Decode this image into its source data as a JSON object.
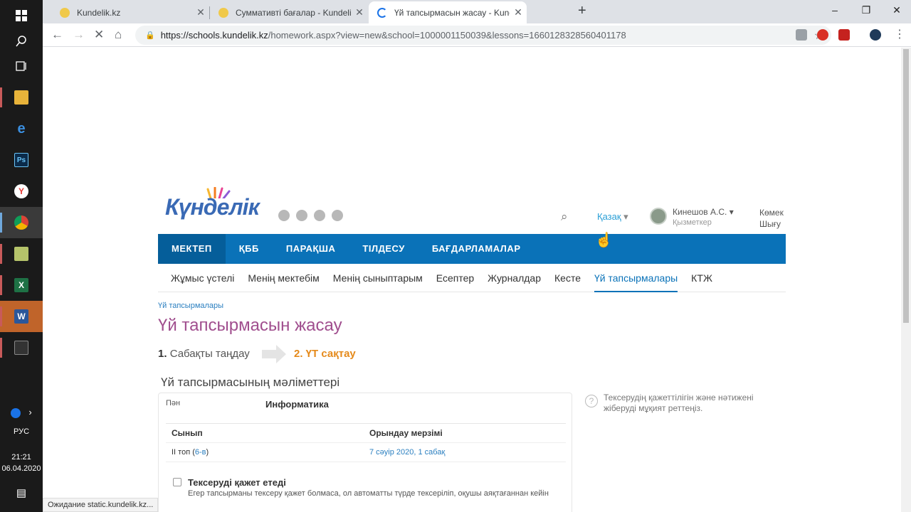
{
  "taskbar": {
    "language": "РУС",
    "time": "21:21",
    "date": "06.04.2020"
  },
  "browser": {
    "tabs": [
      {
        "title": "Kundelik.kz"
      },
      {
        "title": "Суммативті бағалар - Kundelik.k"
      },
      {
        "title": "Үй тапсырмасын жасау - Kunde"
      }
    ],
    "url_domain": "https://schools.kundelik.kz",
    "url_path": "/homework.aspx?view=new&school=1000001150039&lessons=1660128328560401178",
    "status": "Ожидание static.kundelik.kz..."
  },
  "site": {
    "logo": "Күнделік",
    "language": "Қазақ",
    "user_name": "Кинешов А.С.",
    "user_role": "Қызметкер",
    "help": "Көмек",
    "logout": "Шығу"
  },
  "main_nav": [
    "МЕКТЕП",
    "ҚББ",
    "ПАРАҚША",
    "ТІЛДЕСУ",
    "БАҒДАРЛАМАЛАР"
  ],
  "sub_nav": [
    "Жұмыс үстелі",
    "Менің мектебім",
    "Менің сыныптарым",
    "Есептер",
    "Журналдар",
    "Кесте",
    "Үй тапсырмалары",
    "КТЖ"
  ],
  "content": {
    "breadcrumb": "Үй тапсырмалары",
    "page_title": "Үй тапсырмасын жасау",
    "step1_num": "1.",
    "step1_label": "Сабақты таңдау",
    "step2": "2. ҮТ сақтау",
    "section_title": "Үй тапсырмасының мәліметтері",
    "subject_label": "Пән",
    "subject_value": "Информатика",
    "col_class": "Сынып",
    "col_due": "Орындау мерзімі",
    "class_group": "ІІ топ (",
    "class_link": "6-в",
    "class_close": ")",
    "due_value": "7 сәуір 2020, 1 сабақ",
    "check_label": "Тексеруді қажет етеді",
    "check_desc": "Егер тапсырманы тексеру қажет болмаса, ол автоматты түрде тексеріліп, оқушы аяқтағаннан кейін",
    "hint": "Тексерудің қажеттілігін және нәтижені жіберуді мұқият реттеңіз."
  }
}
